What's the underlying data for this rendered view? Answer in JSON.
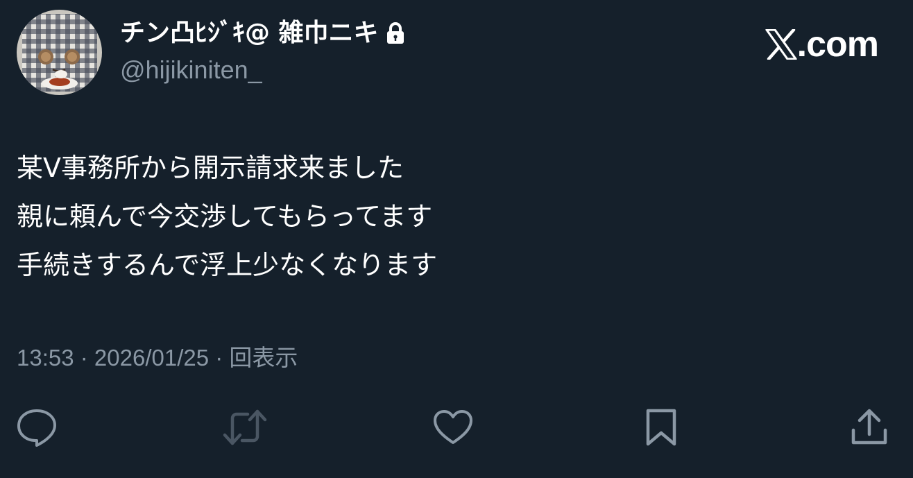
{
  "author": {
    "display_name": "チン凸ﾋｼﾞｷ@ 雑巾ニキ",
    "handle": "@hijikiniten_",
    "protected_icon": "lock-icon",
    "avatar": "avatar-image"
  },
  "brand": {
    "x_glyph": "x-logo-icon",
    "label": ".com"
  },
  "tweet": {
    "lines": [
      "某V事務所から開示請求来ました",
      "親に頼んで今交渉してもらってます",
      "手続きするんで浮上少なくなります"
    ]
  },
  "meta": {
    "time": "13:53",
    "separator": " · ",
    "date": "2026/01/25",
    "views": "回表示"
  },
  "actions": [
    {
      "name": "reply",
      "icon": "reply-icon"
    },
    {
      "name": "retweet",
      "icon": "retweet-icon",
      "disabled": true
    },
    {
      "name": "like",
      "icon": "heart-icon"
    },
    {
      "name": "bookmark",
      "icon": "bookmark-icon"
    },
    {
      "name": "share",
      "icon": "share-icon"
    }
  ],
  "colors": {
    "background": "#15202b",
    "text": "#ffffff",
    "secondary": "#8b98a5",
    "disabled": "#4a5663"
  }
}
